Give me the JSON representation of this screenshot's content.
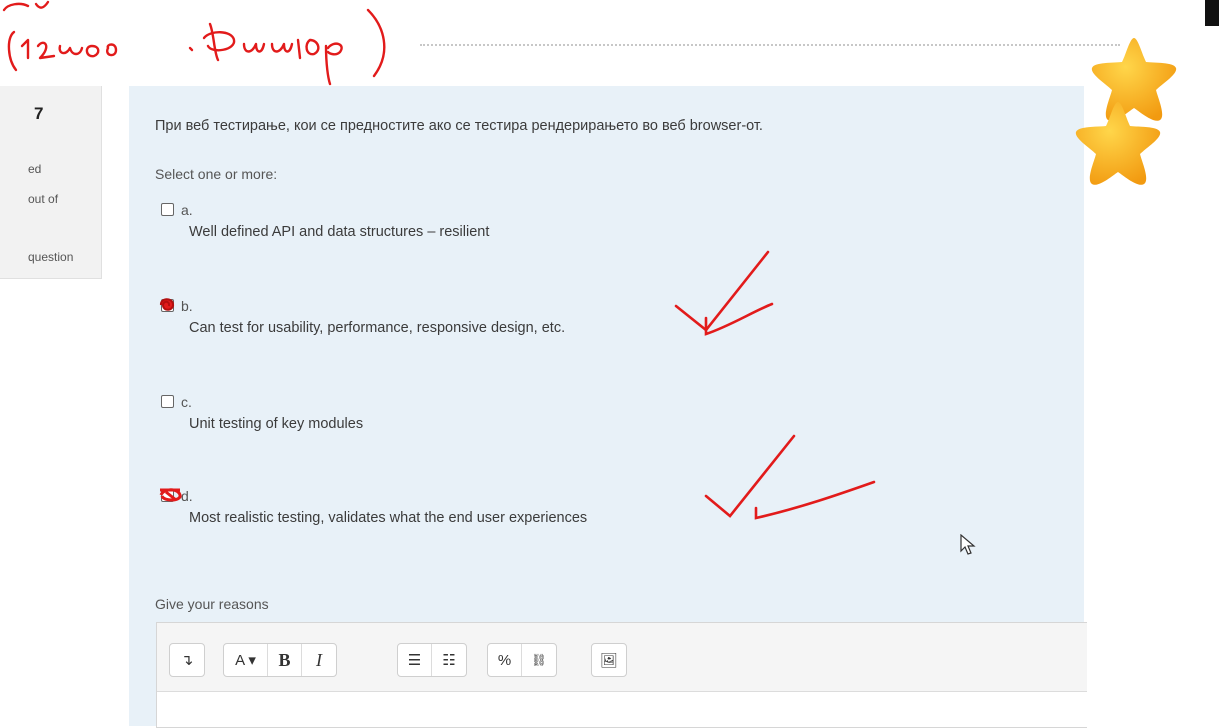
{
  "question": {
    "number_prefix": "",
    "number": "7",
    "status_lines": [
      "ed",
      "out of",
      "",
      "question"
    ],
    "text": "При веб тестирање, кои се предностите ако се тестира рендерирањето во веб browser-от.",
    "prompt": "Select one or more:",
    "options": [
      {
        "letter": "a.",
        "text": "Well defined API and data structures – resilient",
        "checked": false
      },
      {
        "letter": "b.",
        "text": "Can test for usability, performance, responsive design, etc.",
        "checked": true
      },
      {
        "letter": "c.",
        "text": "Unit testing of key modules",
        "checked": false
      },
      {
        "letter": "d.",
        "text": "Most realistic testing, validates what the end user experiences",
        "checked": true
      }
    ],
    "reasons_label": "Give your reasons"
  },
  "editor": {
    "toolbar": [
      {
        "name": "expand-toolbar-icon",
        "glyph": "↴"
      },
      {
        "name": "font-size-icon",
        "glyph": "A ▾"
      },
      {
        "name": "bold-icon",
        "glyph": "B"
      },
      {
        "name": "italic-icon",
        "glyph": "I"
      },
      {
        "name": "unordered-list-icon",
        "glyph": "☰"
      },
      {
        "name": "ordered-list-icon",
        "glyph": "☷"
      },
      {
        "name": "link-icon",
        "glyph": "%"
      },
      {
        "name": "unlink-icon",
        "glyph": "⛓"
      },
      {
        "name": "image-icon",
        "glyph": "🖼"
      }
    ]
  },
  "colors": {
    "panel": "#e8f1f8",
    "ink": "#e01818",
    "star": "#ffb61c"
  }
}
